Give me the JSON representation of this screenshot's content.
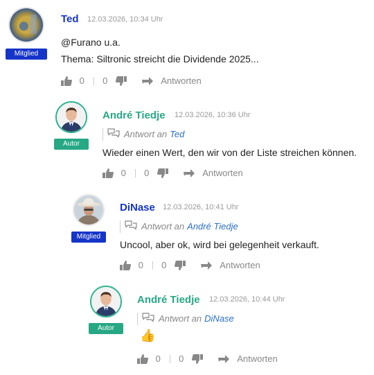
{
  "comments": [
    {
      "author": "Ted",
      "time": "12.03.2026, 10:34 Uhr",
      "badge": "Mitglied",
      "role": "member",
      "lines": [
        "@Furano u.a.",
        "Thema: Siltronic streicht die Dividende 2025..."
      ],
      "likes": "0",
      "dislikes": "0",
      "reply_label": "Antworten"
    },
    {
      "author": "André Tiedje",
      "time": "12.03.2026, 10:36 Uhr",
      "badge": "Autor",
      "role": "author",
      "reply_to_prefix": "Antwort an",
      "reply_to": "Ted",
      "lines": [
        "Wieder einen Wert, den wir von der Liste streichen können."
      ],
      "likes": "0",
      "dislikes": "0",
      "reply_label": "Antworten"
    },
    {
      "author": "DiNase",
      "time": "12.03.2026, 10:41 Uhr",
      "badge": "Mitglied",
      "role": "member",
      "reply_to_prefix": "Antwort an",
      "reply_to": "André Tiedje",
      "lines": [
        "Uncool, aber ok, wird bei gelegenheit verkauft."
      ],
      "likes": "0",
      "dislikes": "0",
      "reply_label": "Antworten"
    },
    {
      "author": "André Tiedje",
      "time": "12.03.2026, 10:44 Uhr",
      "badge": "Autor",
      "role": "author",
      "reply_to_prefix": "Antwort an",
      "reply_to": "DiNase",
      "emoji": "👍",
      "likes": "0",
      "dislikes": "0",
      "reply_label": "Antworten"
    }
  ],
  "colors": {
    "member": "#1534c9",
    "author": "#27a884",
    "link": "#2b6fc7",
    "muted": "#888888"
  }
}
